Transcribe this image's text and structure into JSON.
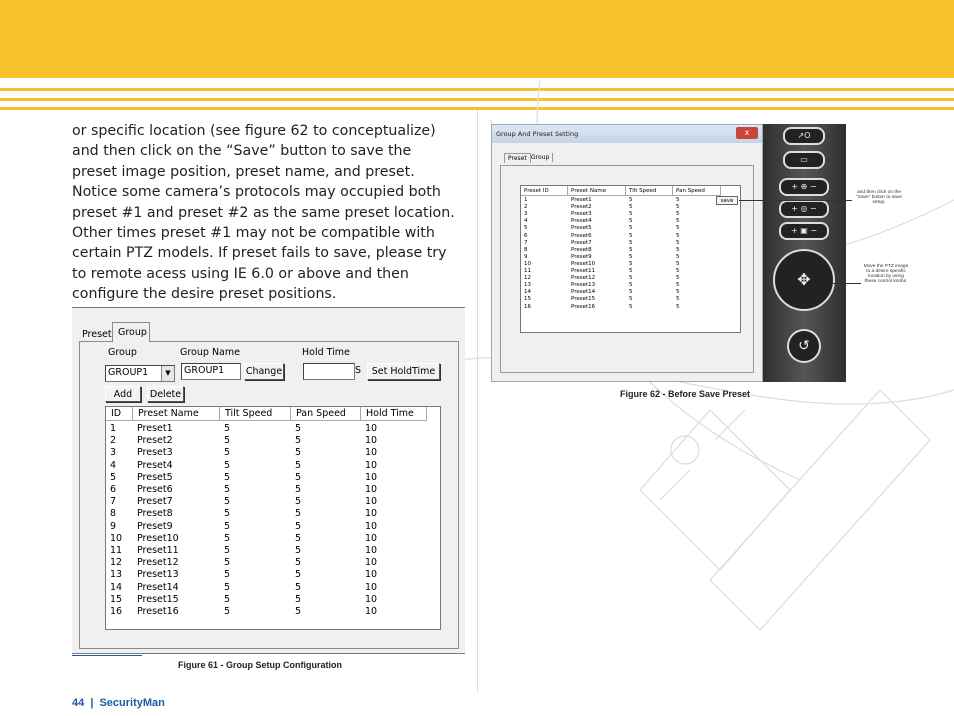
{
  "colors": {
    "banner": "#f7c12c",
    "footer_text": "#1b5aa4"
  },
  "paragraph": "or specific location (see figure 62 to conceptualize) and then click on the “Save” button to save the preset image position, preset name, and preset. Notice some camera’s protocols may occupied both preset #1 and preset #2 as the same preset location. Other times preset #1 may not be compatible with certain PTZ models.  If preset fails to save, please try to remote acess using IE 6.0 or above and then configure the desire preset positions.",
  "figure61": {
    "caption": "Figure 61 - Group Setup Configuration",
    "tabs": [
      "Preset",
      "Group"
    ],
    "labels": {
      "group": "Group",
      "group_name": "Group Name",
      "hold_time": "Hold Time",
      "s_unit": "S"
    },
    "group_select_value": "GROUP1",
    "group_name_value": "GROUP1",
    "hold_time_value": "",
    "buttons": {
      "change": "Change",
      "set_hold_time": "Set HoldTime",
      "add": "Add",
      "delete": "Delete"
    },
    "columns": [
      "ID",
      "Preset Name",
      "Tilt Speed",
      "Pan Speed",
      "Hold Time"
    ],
    "rows": [
      [
        "1",
        "Preset1",
        "5",
        "5",
        "10"
      ],
      [
        "2",
        "Preset2",
        "5",
        "5",
        "10"
      ],
      [
        "3",
        "Preset3",
        "5",
        "5",
        "10"
      ],
      [
        "4",
        "Preset4",
        "5",
        "5",
        "10"
      ],
      [
        "5",
        "Preset5",
        "5",
        "5",
        "10"
      ],
      [
        "6",
        "Preset6",
        "5",
        "5",
        "10"
      ],
      [
        "7",
        "Preset7",
        "5",
        "5",
        "10"
      ],
      [
        "8",
        "Preset8",
        "5",
        "5",
        "10"
      ],
      [
        "9",
        "Preset9",
        "5",
        "5",
        "10"
      ],
      [
        "10",
        "Preset10",
        "5",
        "5",
        "10"
      ],
      [
        "11",
        "Preset11",
        "5",
        "5",
        "10"
      ],
      [
        "12",
        "Preset12",
        "5",
        "5",
        "10"
      ],
      [
        "13",
        "Preset13",
        "5",
        "5",
        "10"
      ],
      [
        "14",
        "Preset14",
        "5",
        "5",
        "10"
      ],
      [
        "15",
        "Preset15",
        "5",
        "5",
        "10"
      ],
      [
        "16",
        "Preset16",
        "5",
        "5",
        "10"
      ]
    ]
  },
  "figure62": {
    "caption": "Figure 62  - Before Save Preset",
    "window_title": "Group And Preset Setting",
    "close_glyph": "x",
    "tabs": [
      "Preset",
      "Group"
    ],
    "columns": [
      "Preset ID",
      "Preset Name",
      "Tilt Speed",
      "Pan Speed"
    ],
    "save_label": "save",
    "rows": [
      [
        "1",
        "Preset1",
        "5",
        "5"
      ],
      [
        "2",
        "Preset2",
        "5",
        "5"
      ],
      [
        "3",
        "Preset3",
        "5",
        "5"
      ],
      [
        "4",
        "Preset4",
        "5",
        "5"
      ],
      [
        "5",
        "Preset5",
        "5",
        "5"
      ],
      [
        "6",
        "Preset6",
        "5",
        "5"
      ],
      [
        "7",
        "Preset7",
        "5",
        "5"
      ],
      [
        "8",
        "Preset8",
        "5",
        "5"
      ],
      [
        "9",
        "Preset9",
        "5",
        "5"
      ],
      [
        "10",
        "Preset10",
        "5",
        "5"
      ],
      [
        "11",
        "Preset11",
        "5",
        "5"
      ],
      [
        "12",
        "Preset12",
        "5",
        "5"
      ],
      [
        "13",
        "Preset13",
        "5",
        "5"
      ],
      [
        "14",
        "Preset14",
        "5",
        "5"
      ],
      [
        "15",
        "Preset15",
        "5",
        "5"
      ],
      [
        "16",
        "Preset16",
        "5",
        "5"
      ]
    ],
    "annotations": {
      "save_note": "and then click on the \"Save\" button to save setup.",
      "ptz_note": "Move the PTZ image to a desire specific location by using these control knobs."
    },
    "control_icons": [
      "exit-icon",
      "monitor-icon",
      "zoom-icon",
      "focus-icon",
      "iris-icon",
      "direction-pad-icon",
      "return-icon"
    ]
  },
  "footer": {
    "page_number": "44",
    "separator": "|",
    "brand": "SecurityMan"
  }
}
